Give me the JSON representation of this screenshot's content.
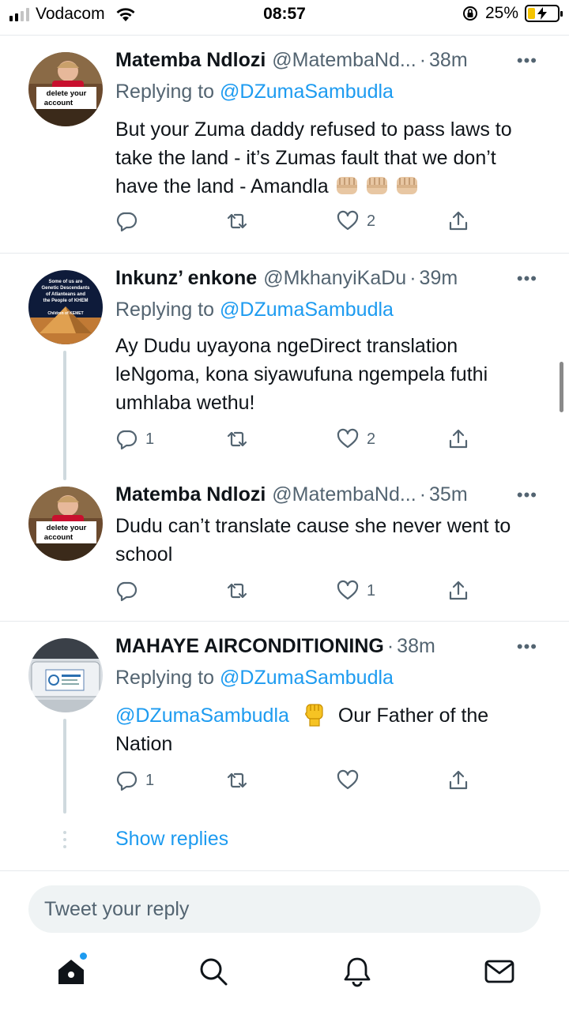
{
  "status_bar": {
    "carrier": "Vodacom",
    "time": "08:57",
    "battery": "25%",
    "battery_level": 0.25
  },
  "tweets": [
    {
      "name": "Matemba Ndlozi",
      "handle": "@MatembaNd...",
      "time": "38m",
      "replying_prefix": "Replying to",
      "replying_to": "@DZumaSambudla",
      "text": "But your Zuma daddy refused to pass laws to take the land - it’s Zumas fault that we don’t have the land - Amandla",
      "emoji": "oncoming-fist-x3",
      "replies": "",
      "likes": "2",
      "avatar_sign": "delete your account"
    },
    {
      "name": "Inkunz’ enkone",
      "handle": "@MkhanyiKaDu",
      "time": "39m",
      "replying_prefix": "Replying to",
      "replying_to": "@DZumaSambudla",
      "text": "Ay Dudu uyayona ngeDirect translation leNgoma, kona siyawufuna ngempela futhi umhlaba wethu!",
      "replies": "1",
      "likes": "2",
      "avatar_lines": [
        "Some of us are",
        "Genetic Descendants",
        "of Atlanteans and",
        "the People of KHEM",
        "Children of KEMET"
      ]
    },
    {
      "name": "Matemba Ndlozi",
      "handle": "@MatembaNd...",
      "time": "35m",
      "text": "Dudu can’t translate cause she never went to school",
      "replies": "",
      "likes": "1",
      "avatar_sign": "delete your account"
    },
    {
      "name": "MAHAYE AIRCONDITIONING",
      "handle": "",
      "time": "38m",
      "replying_prefix": "Replying to",
      "replying_to": "@DZumaSambudla",
      "mention": "@DZumaSambudla",
      "emoji": "raised-fist",
      "text": "Our Father of the Nation",
      "replies": "1",
      "likes": ""
    }
  ],
  "show_replies": "Show replies",
  "reply_box": {
    "placeholder": "Tweet your reply"
  },
  "tabbar": {
    "items": [
      "home-icon",
      "search-icon",
      "notifications-icon",
      "messages-icon"
    ],
    "accent": "#1d9bf0"
  }
}
